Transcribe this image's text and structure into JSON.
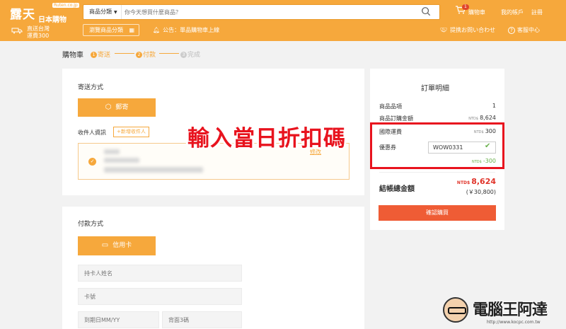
{
  "header": {
    "logo_text": "露天",
    "logo_sub": "日本購物",
    "logo_domain": "Ruten.co.jp",
    "search_category": "商品分類",
    "search_placeholder": "你今天想買什麼商品？",
    "cart_count": "1",
    "cart_label": "購物車",
    "account_label": "我的帳戶",
    "register_label": "註冊",
    "ship_line1": "直送台灣",
    "ship_line2": "運費300",
    "browse_label": "瀏覽商品分類",
    "notice_label": "公告：單品購物車上線",
    "contact_label": "提携お問い合わせ",
    "service_label": "客服中心"
  },
  "breadcrumb": {
    "title": "購物車",
    "steps": [
      {
        "num": "1",
        "label": "寄送",
        "state": "active"
      },
      {
        "num": "2",
        "label": "付款",
        "state": "active"
      },
      {
        "num": "3",
        "label": "完成",
        "state": "inactive"
      }
    ]
  },
  "shipping": {
    "title": "寄送方式",
    "method_label": "郵寄",
    "receiver_label": "收件人資訊",
    "add_receiver_label": "+新增收件人",
    "edit_label": "修改"
  },
  "payment": {
    "title": "付款方式",
    "method_label": "信用卡",
    "cardholder_placeholder": "持卡人姓名",
    "card_number_placeholder": "卡號",
    "expiry_placeholder": "到期日MM/YY",
    "cvv_placeholder": "背面3碼"
  },
  "order": {
    "title": "訂單明細",
    "item_count_label": "商品品項",
    "item_count_value": "1",
    "subtotal_label": "商品訂購金額",
    "currency_small": "NTD$",
    "subtotal_value": "8,624",
    "shipping_label": "國際運費",
    "shipping_value": "300",
    "coupon_label": "優惠券",
    "coupon_code": "WOW0331",
    "discount_value": "-300",
    "total_label": "結帳總金額",
    "total_currency": "NTD$",
    "total_value": "8,624",
    "total_jpy": "(￥30,800)",
    "confirm_label": "確認購買"
  },
  "annotation": {
    "text": "輸入當日折扣碼",
    "color": "#e8131e"
  },
  "watermark": {
    "text": "電腦王阿達",
    "url": "http://www.kocpc.com.tw"
  },
  "colors": {
    "brand": "#f6a83c",
    "confirm": "#ef5c35",
    "success": "#6ab04c",
    "total": "#e0342a"
  }
}
